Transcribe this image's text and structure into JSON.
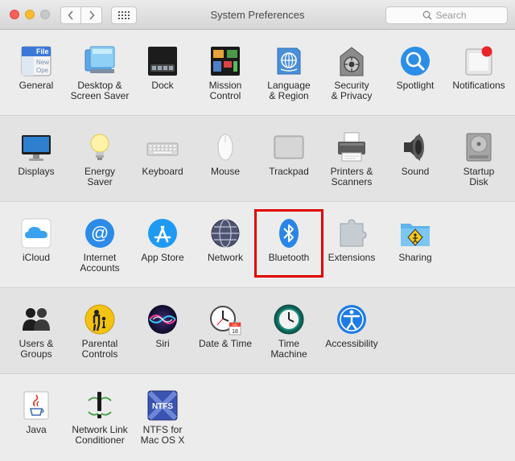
{
  "window": {
    "title": "System Preferences",
    "search_placeholder": "Search"
  },
  "rows": [
    [
      {
        "id": "general",
        "label": "General",
        "icon": "general-icon"
      },
      {
        "id": "desktop",
        "label": "Desktop &\nScreen Saver",
        "icon": "desktop-screensaver-icon"
      },
      {
        "id": "dock",
        "label": "Dock",
        "icon": "dock-icon"
      },
      {
        "id": "mission",
        "label": "Mission\nControl",
        "icon": "mission-control-icon"
      },
      {
        "id": "language",
        "label": "Language\n& Region",
        "icon": "language-region-icon"
      },
      {
        "id": "security",
        "label": "Security\n& Privacy",
        "icon": "security-privacy-icon"
      },
      {
        "id": "spotlight",
        "label": "Spotlight",
        "icon": "spotlight-icon"
      },
      {
        "id": "notifications",
        "label": "Notifications",
        "icon": "notifications-icon"
      }
    ],
    [
      {
        "id": "displays",
        "label": "Displays",
        "icon": "displays-icon"
      },
      {
        "id": "energy",
        "label": "Energy\nSaver",
        "icon": "energy-saver-icon"
      },
      {
        "id": "keyboard",
        "label": "Keyboard",
        "icon": "keyboard-icon"
      },
      {
        "id": "mouse",
        "label": "Mouse",
        "icon": "mouse-icon"
      },
      {
        "id": "trackpad",
        "label": "Trackpad",
        "icon": "trackpad-icon"
      },
      {
        "id": "printers",
        "label": "Printers &\nScanners",
        "icon": "printers-scanners-icon"
      },
      {
        "id": "sound",
        "label": "Sound",
        "icon": "sound-icon"
      },
      {
        "id": "startup",
        "label": "Startup\nDisk",
        "icon": "startup-disk-icon"
      }
    ],
    [
      {
        "id": "icloud",
        "label": "iCloud",
        "icon": "icloud-icon"
      },
      {
        "id": "internet",
        "label": "Internet\nAccounts",
        "icon": "internet-accounts-icon"
      },
      {
        "id": "appstore",
        "label": "App Store",
        "icon": "app-store-icon"
      },
      {
        "id": "network",
        "label": "Network",
        "icon": "network-icon"
      },
      {
        "id": "bluetooth",
        "label": "Bluetooth",
        "icon": "bluetooth-icon"
      },
      {
        "id": "extensions",
        "label": "Extensions",
        "icon": "extensions-icon"
      },
      {
        "id": "sharing",
        "label": "Sharing",
        "icon": "sharing-icon"
      }
    ],
    [
      {
        "id": "users",
        "label": "Users &\nGroups",
        "icon": "users-groups-icon"
      },
      {
        "id": "parental",
        "label": "Parental\nControls",
        "icon": "parental-controls-icon"
      },
      {
        "id": "siri",
        "label": "Siri",
        "icon": "siri-icon"
      },
      {
        "id": "datetime",
        "label": "Date & Time",
        "icon": "date-time-icon"
      },
      {
        "id": "timemachine",
        "label": "Time\nMachine",
        "icon": "time-machine-icon"
      },
      {
        "id": "accessibility",
        "label": "Accessibility",
        "icon": "accessibility-icon"
      }
    ],
    [
      {
        "id": "java",
        "label": "Java",
        "icon": "java-icon"
      },
      {
        "id": "nlc",
        "label": "Network Link\nConditioner",
        "icon": "network-link-conditioner-icon"
      },
      {
        "id": "ntfs",
        "label": "NTFS for\nMac OS X",
        "icon": "ntfs-icon"
      }
    ]
  ],
  "icon_text": {
    "general_file": "File",
    "general_new": "New",
    "general_open": "Ope",
    "calendar_month": "JUL",
    "calendar_day": "18",
    "ntfs": "NTFS"
  },
  "highlight": {
    "target": "bluetooth",
    "color": "#e00000"
  }
}
